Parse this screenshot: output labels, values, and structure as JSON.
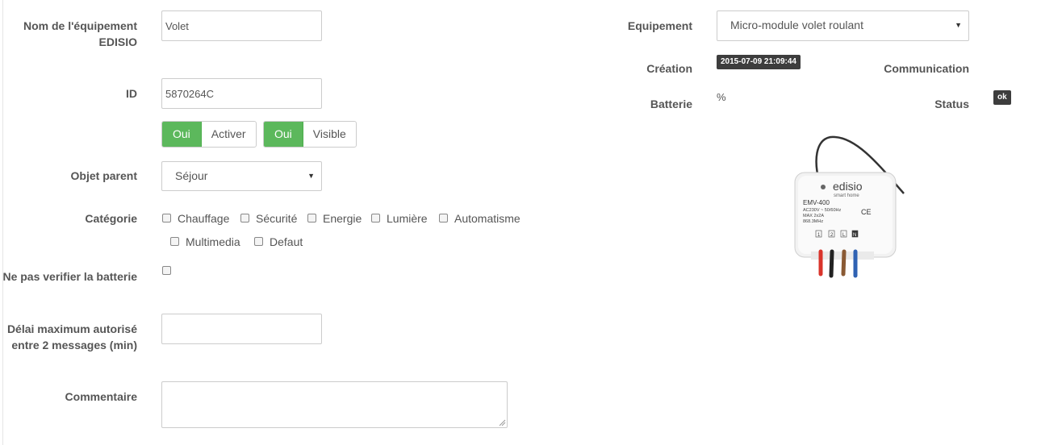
{
  "form": {
    "name_label": "Nom de l'équipement EDISIO",
    "name_value": "Volet",
    "id_label": "ID",
    "id_value": "5870264C",
    "activate": {
      "on": "Oui",
      "label": "Activer"
    },
    "visible": {
      "on": "Oui",
      "label": "Visible"
    },
    "parent_label": "Objet parent",
    "parent_value": "Séjour",
    "category_label": "Catégorie",
    "categories": [
      "Chauffage",
      "Sécurité",
      "Energie",
      "Lumière",
      "Automatisme",
      "Multimedia",
      "Defaut"
    ],
    "battery_check_label": "Ne pas verifier la batterie",
    "delay_label": "Délai maximum autorisé entre 2 messages (min)",
    "delay_value": "",
    "comment_label": "Commentaire",
    "comment_value": ""
  },
  "info": {
    "equipment_label": "Equipement",
    "equipment_value": "Micro-module volet roulant",
    "creation_label": "Création",
    "creation_value": "2015-07-09 21:09:44",
    "communication_label": "Communication",
    "battery_label": "Batterie",
    "battery_value": "%",
    "status_label": "Status",
    "status_value": "ok"
  },
  "product": {
    "brand": "edisio",
    "brand_sub": "smart home",
    "model": "EMV-400",
    "spec1": "AC230V ~ 50/60Hz",
    "spec2": "MAX 2x2A",
    "spec3": "868.3MHz",
    "terminals": [
      "1",
      "2",
      "L",
      "N"
    ]
  },
  "colors": {
    "success": "#5cb85c",
    "badge": "#3d3d3d"
  }
}
